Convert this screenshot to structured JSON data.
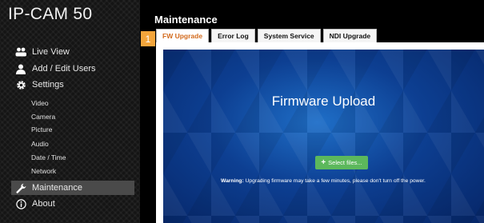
{
  "app": {
    "logo": "IP-CAM 50"
  },
  "sidebar": {
    "main_items": [
      {
        "label": "Live View",
        "icon": "users-icon"
      },
      {
        "label": "Add / Edit Users",
        "icon": "user-icon"
      },
      {
        "label": "Settings",
        "icon": "gear-icon"
      },
      {
        "label": "Maintenance",
        "icon": "wrench-icon",
        "active": true
      },
      {
        "label": "About",
        "icon": "info-icon"
      }
    ],
    "settings_sub": [
      "Video",
      "Camera",
      "Picture",
      "Audio",
      "Date / Time",
      "Network"
    ]
  },
  "main": {
    "title": "Maintenance",
    "tab_badge": "1",
    "tabs": [
      {
        "label": "FW Upgrade",
        "active": true
      },
      {
        "label": "Error Log"
      },
      {
        "label": "System Service"
      },
      {
        "label": "NDI Upgrade"
      }
    ],
    "upload": {
      "title": "Firmware Upload",
      "select_button": "Select files...",
      "warning_label": "Warning:",
      "warning_text": "Upgrading firmware may take a few minutes, please don't turn off the power."
    }
  },
  "colors": {
    "active_tab_text": "#d36b1e",
    "badge": "#f3a53b",
    "select_button": "#5cb85c",
    "panel_blue": "#0d3f92"
  }
}
